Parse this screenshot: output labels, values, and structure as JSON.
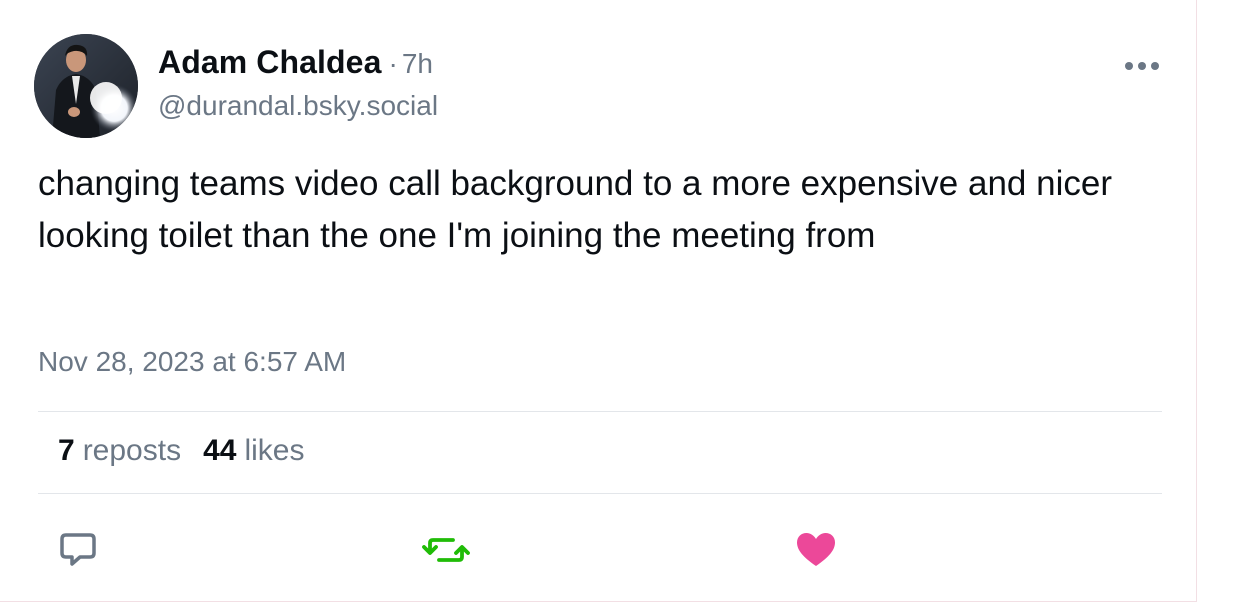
{
  "author": {
    "display_name": "Adam Chaldea",
    "separator": "·",
    "time_ago": "7h",
    "handle": "@durandal.bsky.social"
  },
  "post": {
    "text": "changing teams video call background to a more expensive and nicer looking toilet than the one I'm joining the meeting from",
    "timestamp": "Nov 28, 2023 at 6:57 AM"
  },
  "stats": {
    "reposts_count": "7",
    "reposts_label": "reposts",
    "likes_count": "44",
    "likes_label": "likes"
  },
  "icons": {
    "more": "more-options-icon",
    "reply": "reply-icon",
    "repost": "repost-icon",
    "like": "heart-icon"
  },
  "colors": {
    "text_primary": "#0b0f14",
    "text_secondary": "#6b7785",
    "repost_green": "#20bc07",
    "like_pink": "#ec4899",
    "reply_gray": "#6b7785",
    "divider": "#e3e6ea"
  }
}
